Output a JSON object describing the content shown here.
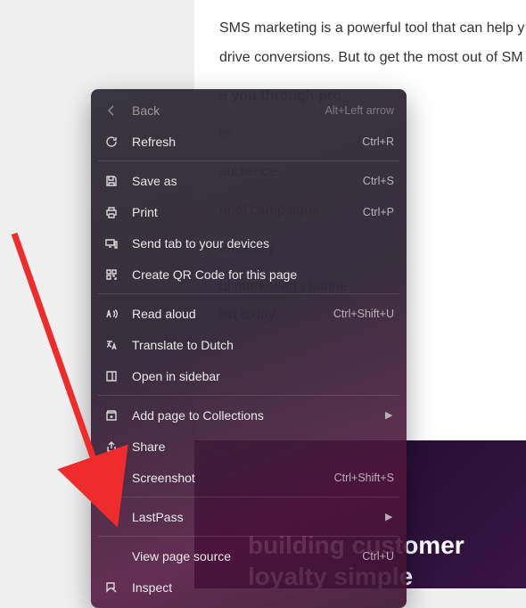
{
  "article": {
    "p1": "SMS marketing is a powerful tool that can help y",
    "p2": "drive conversions. But to get the most out of SM",
    "lead_bold": "e you through pro",
    "b1": "rs",
    "b2": "audience",
    "b3": "nnel campaigns",
    "b4": "amlessly",
    "tail1": "ul marketing channe",
    "tail2": "list today."
  },
  "banner": {
    "line1": "building customer",
    "line2": "loyalty simple"
  },
  "menu": {
    "back": {
      "label": "Back",
      "shortcut": "Alt+Left arrow"
    },
    "refresh": {
      "label": "Refresh",
      "shortcut": "Ctrl+R"
    },
    "saveas": {
      "label": "Save as",
      "shortcut": "Ctrl+S"
    },
    "print": {
      "label": "Print",
      "shortcut": "Ctrl+P"
    },
    "sendtab": {
      "label": "Send tab to your devices"
    },
    "qr": {
      "label": "Create QR Code for this page"
    },
    "readaloud": {
      "label": "Read aloud",
      "shortcut": "Ctrl+Shift+U"
    },
    "translate": {
      "label": "Translate to Dutch"
    },
    "sidebar": {
      "label": "Open in sidebar"
    },
    "collections": {
      "label": "Add page to Collections",
      "submenu": "▶"
    },
    "share": {
      "label": "Share"
    },
    "screenshot": {
      "label": "Screenshot",
      "shortcut": "Ctrl+Shift+S"
    },
    "lastpass": {
      "label": "LastPass",
      "submenu": "▶"
    },
    "viewsource": {
      "label": "View page source",
      "shortcut": "Ctrl+U"
    },
    "inspect": {
      "label": "Inspect"
    }
  }
}
